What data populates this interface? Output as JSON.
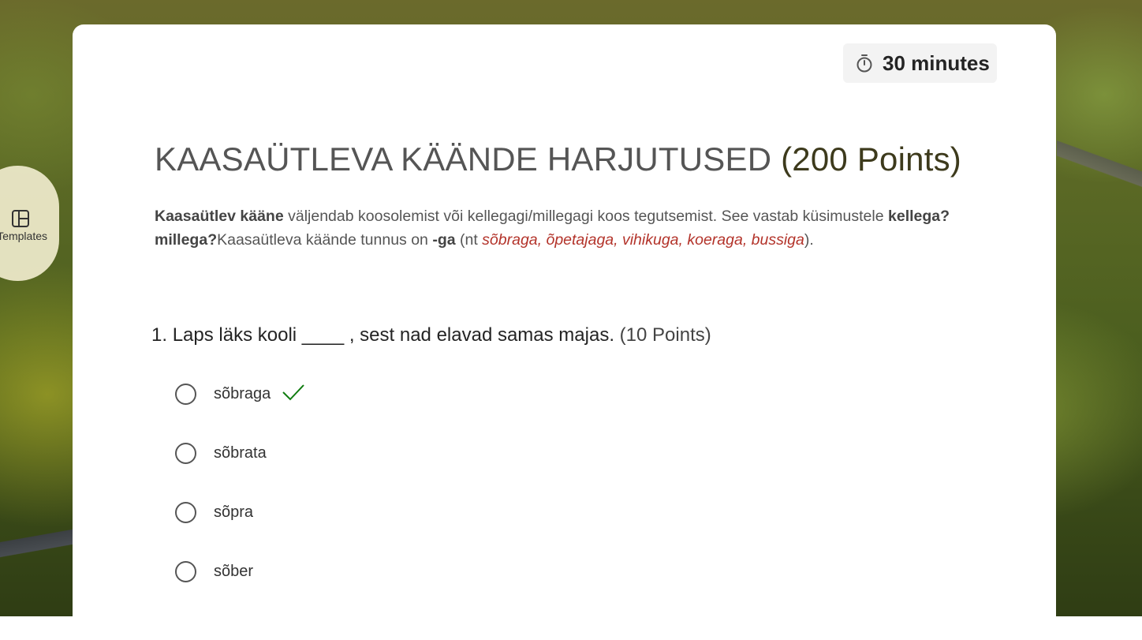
{
  "timer": {
    "icon": "stopwatch-icon",
    "label": "30 minutes"
  },
  "templates": {
    "icon": "layout-icon",
    "label": "Templates"
  },
  "form": {
    "title": "KAASAÜTLEVA KÄÄNDE HARJUTUSED",
    "title_points": "(200 Points)",
    "description": {
      "p1_bold": "Kaasaütlev kääne",
      "p2": " väljendab koosolemist või kellegagi/millegagi koos tegutsemist. See vastab küsimustele ",
      "p3_bold": "kellega? millega?",
      "p4": "Kaasaütleva käände tunnus on ",
      "p5_bold": "-ga",
      "p6": " (nt ",
      "p7_examples": "sõbraga, õpetajaga, vihikuga, koeraga, bussiga",
      "p8": ")."
    }
  },
  "question": {
    "number": "1.",
    "text": "Laps läks kooli ____ , sest nad elavad samas majas.",
    "points": "(10 Points)",
    "options": [
      {
        "label": "sõbraga",
        "correct": true
      },
      {
        "label": "sõbrata",
        "correct": false
      },
      {
        "label": "sõpra",
        "correct": false
      },
      {
        "label": "sõber",
        "correct": false
      }
    ]
  },
  "colors": {
    "card_bg": "#ffffff",
    "title": "#555555",
    "example_red": "#b3332a",
    "check_green": "#107c10",
    "timer_bg": "#f3f3f3"
  }
}
